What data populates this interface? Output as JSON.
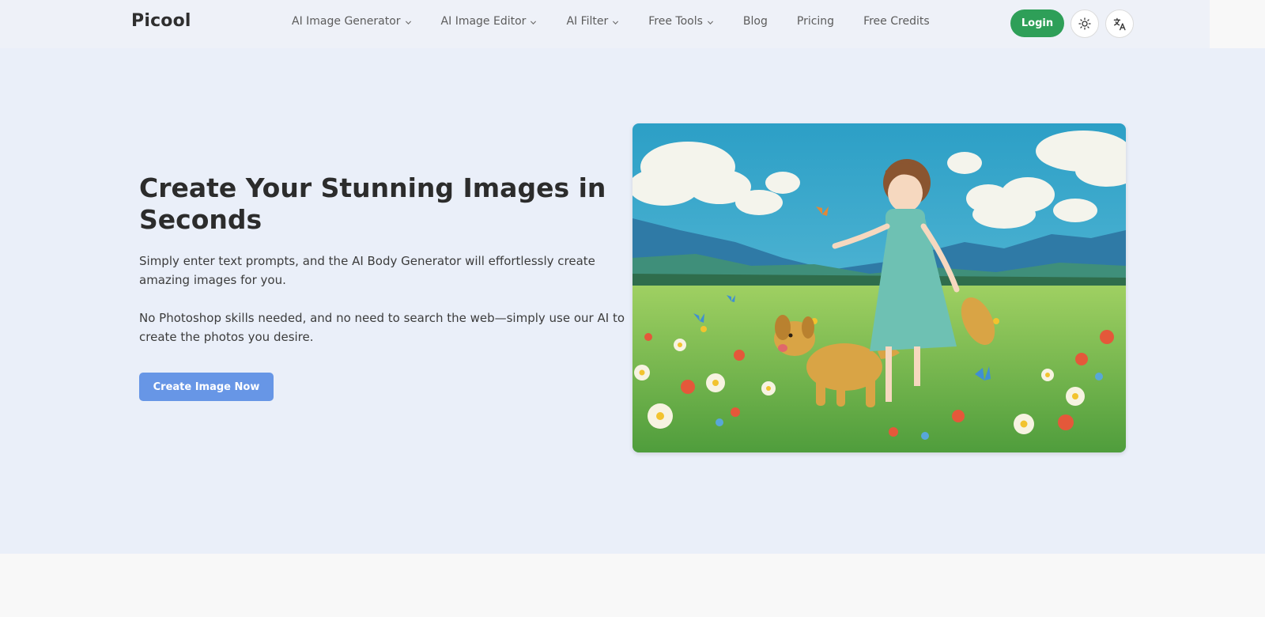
{
  "header": {
    "logo": "Picool",
    "nav": [
      {
        "label": "AI Image Generator",
        "dropdown": true
      },
      {
        "label": "AI Image Editor",
        "dropdown": true
      },
      {
        "label": "AI Filter",
        "dropdown": true
      },
      {
        "label": "Free Tools",
        "dropdown": true
      },
      {
        "label": "Blog",
        "dropdown": false
      },
      {
        "label": "Pricing",
        "dropdown": false
      },
      {
        "label": "Free Credits",
        "dropdown": false
      }
    ],
    "login_label": "Login",
    "theme_icon": "sun-icon",
    "language_icon": "translate-icon"
  },
  "hero": {
    "title": "Create Your Stunning Images in Seconds",
    "description_1": "Simply enter text prompts, and the AI Body Generator will effortlessly create amazing images for you.",
    "description_2": "No Photoshop skills needed, and no need to search the web—simply use our AI to create the photos you desire.",
    "cta_label": "Create Image Now",
    "image_subject": "anime-style girl with dog in flower meadow"
  },
  "colors": {
    "header_bg": "#eef1f8",
    "hero_bg": "#eaeff9",
    "login_green": "#2e9f58",
    "cta_blue": "#6796e6",
    "footer_bg": "#f8f8f8"
  }
}
